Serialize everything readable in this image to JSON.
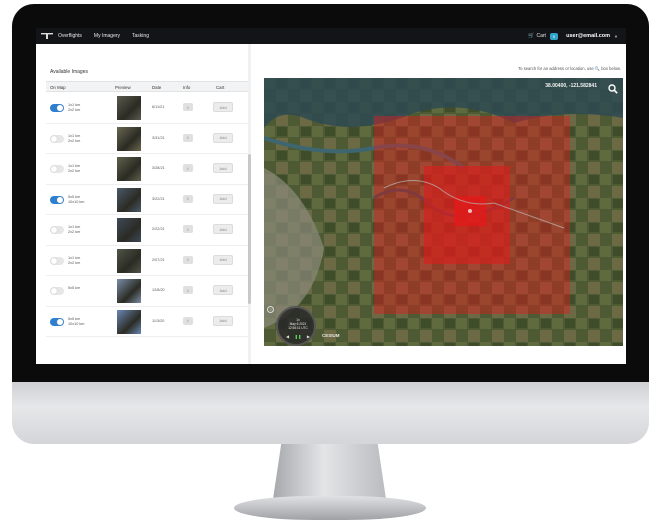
{
  "navbar": {
    "logo_icon": "drone-icon",
    "links": [
      "Overflights",
      "My Imagery",
      "Tasking"
    ],
    "cart_label": "Cart",
    "cart_count": "0",
    "user_email": "user@email.com"
  },
  "panel": {
    "title": "Available Images",
    "columns": [
      "On Map",
      "Preview",
      "Date",
      "Info",
      "Cart"
    ],
    "add_label": "Add",
    "info_label": "i",
    "rows": [
      {
        "on": true,
        "res1": "1x1 km",
        "res2": "2x2 km",
        "date": "6/11/21",
        "thumb": "#5a5a4e"
      },
      {
        "on": false,
        "res1": "1x1 km",
        "res2": "2x2 km",
        "date": "3/31/21",
        "thumb": "#6a6850"
      },
      {
        "on": false,
        "res1": "1x1 km",
        "res2": "2x2 km",
        "date": "3/28/21",
        "thumb": "#60624a"
      },
      {
        "on": true,
        "res1": "5x5 km",
        "res2": "10x10 km",
        "date": "3/22/21",
        "thumb": "#4a5a6a"
      },
      {
        "on": false,
        "res1": "1x1 km",
        "res2": "2x2 km",
        "date": "2/22/21",
        "thumb": "#3e4a5a"
      },
      {
        "on": false,
        "res1": "1x1 km",
        "res2": "2x2 km",
        "date": "2/07/21",
        "thumb": "#505448"
      },
      {
        "on": false,
        "res1": "5x5 km",
        "res2": "",
        "date": "12/8/20",
        "thumb": "#7a8ea6"
      },
      {
        "on": true,
        "res1": "5x5 km",
        "res2": "10x10 km",
        "date": "11/3/20",
        "thumb": "#6a88b4"
      }
    ]
  },
  "map": {
    "search_hint": "To search for an address or location, use 🔍 box below.",
    "coords": "38.00400, -121.582841",
    "search_icon": "search-icon",
    "timeline_lines": [
      "1x",
      "May 6 2021",
      "12:54:11 UTC"
    ],
    "attribution": "CESIUM",
    "overlay_color": "#e31a1a"
  }
}
